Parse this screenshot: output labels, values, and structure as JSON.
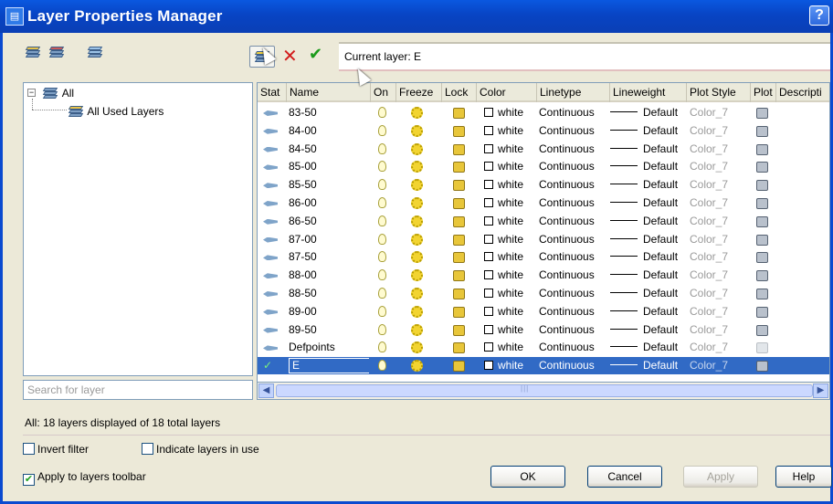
{
  "window": {
    "title": "Layer Properties Manager",
    "help_label": "?"
  },
  "toolbar": {
    "current_layer_label": "Current layer: E",
    "icons": [
      "new-property-filter-icon",
      "new-group-filter-icon",
      "layer-states-manager-icon",
      "new-layer-icon",
      "delete-layer-icon",
      "set-current-icon"
    ]
  },
  "tree": {
    "root_label": "All",
    "child_label": "All Used Layers",
    "search_placeholder": "Search for layer"
  },
  "grid": {
    "columns": [
      "Stat",
      "Name",
      "On",
      "Freeze",
      "Lock",
      "Color",
      "Linetype",
      "Lineweight",
      "Plot Style",
      "Plot",
      "Descripti"
    ],
    "rows": [
      {
        "name": "83-50",
        "color": "white",
        "linetype": "Continuous",
        "lineweight": "Default",
        "plot_style": "Color_7"
      },
      {
        "name": "84-00",
        "color": "white",
        "linetype": "Continuous",
        "lineweight": "Default",
        "plot_style": "Color_7"
      },
      {
        "name": "84-50",
        "color": "white",
        "linetype": "Continuous",
        "lineweight": "Default",
        "plot_style": "Color_7"
      },
      {
        "name": "85-00",
        "color": "white",
        "linetype": "Continuous",
        "lineweight": "Default",
        "plot_style": "Color_7"
      },
      {
        "name": "85-50",
        "color": "white",
        "linetype": "Continuous",
        "lineweight": "Default",
        "plot_style": "Color_7"
      },
      {
        "name": "86-00",
        "color": "white",
        "linetype": "Continuous",
        "lineweight": "Default",
        "plot_style": "Color_7"
      },
      {
        "name": "86-50",
        "color": "white",
        "linetype": "Continuous",
        "lineweight": "Default",
        "plot_style": "Color_7"
      },
      {
        "name": "87-00",
        "color": "white",
        "linetype": "Continuous",
        "lineweight": "Default",
        "plot_style": "Color_7"
      },
      {
        "name": "87-50",
        "color": "white",
        "linetype": "Continuous",
        "lineweight": "Default",
        "plot_style": "Color_7"
      },
      {
        "name": "88-00",
        "color": "white",
        "linetype": "Continuous",
        "lineweight": "Default",
        "plot_style": "Color_7"
      },
      {
        "name": "88-50",
        "color": "white",
        "linetype": "Continuous",
        "lineweight": "Default",
        "plot_style": "Color_7"
      },
      {
        "name": "89-00",
        "color": "white",
        "linetype": "Continuous",
        "lineweight": "Default",
        "plot_style": "Color_7"
      },
      {
        "name": "89-50",
        "color": "white",
        "linetype": "Continuous",
        "lineweight": "Default",
        "plot_style": "Color_7"
      },
      {
        "name": "Defpoints",
        "color": "white",
        "linetype": "Continuous",
        "lineweight": "Default",
        "plot_style": "Color_7"
      },
      {
        "name": "E",
        "color": "white",
        "linetype": "Continuous",
        "lineweight": "Default",
        "plot_style": "Color_7",
        "selected": true
      }
    ]
  },
  "status": {
    "summary": "All: 18 layers displayed of 18 total layers"
  },
  "options": {
    "invert_filter": {
      "label": "Invert filter",
      "checked": false
    },
    "indicate_in_use": {
      "label": "Indicate layers in use",
      "checked": false
    },
    "apply_toolbar": {
      "label": "Apply to layers toolbar",
      "checked": true
    }
  },
  "buttons": {
    "ok": "OK",
    "cancel": "Cancel",
    "apply": "Apply",
    "help": "Help"
  },
  "colors": {
    "titlebar": "#0a4ad0",
    "selection": "#316ac5",
    "dialog": "#ece9d8"
  }
}
